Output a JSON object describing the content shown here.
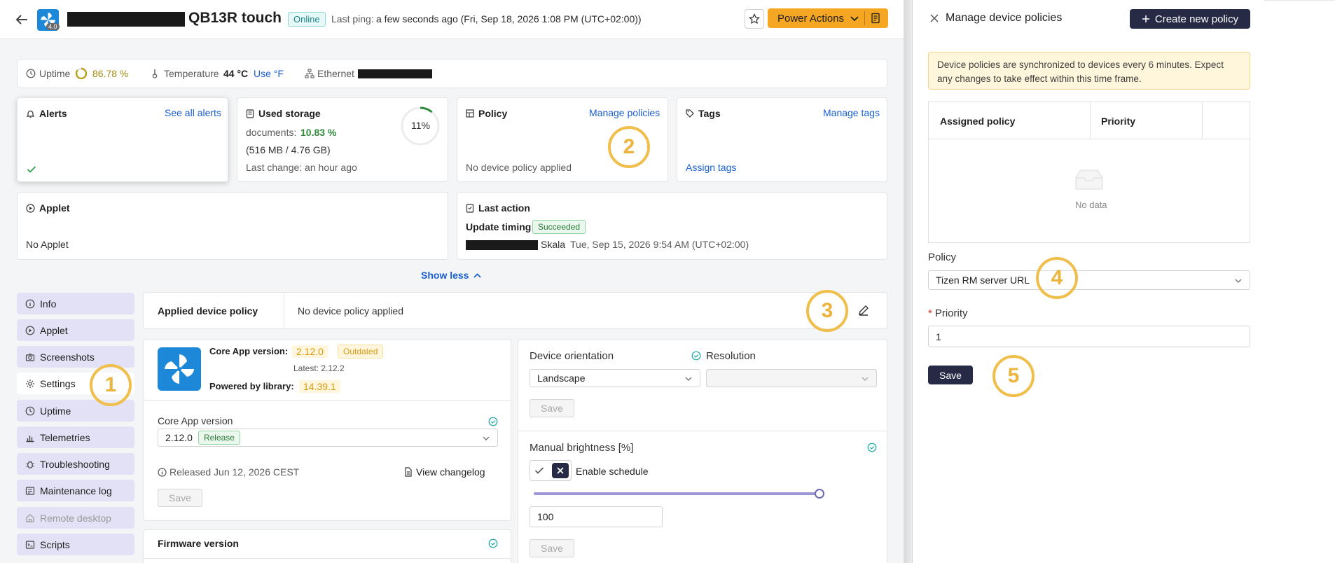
{
  "header": {
    "device_name": "QB13R touch",
    "version_badge": "4.0",
    "status": "Online",
    "last_ping_label": "Last ping:",
    "last_ping_value": "a few seconds ago (Fri, Sep 18, 2026 1:08 PM (UTC+02:00))",
    "power_actions": "Power Actions"
  },
  "info_bar": {
    "uptime_label": "Uptime",
    "uptime_value": "86.78 %",
    "temperature_label": "Temperature",
    "temperature_value": "44 °C",
    "use_f": "Use °F",
    "ethernet_label": "Ethernet"
  },
  "alerts": {
    "title": "Alerts",
    "see_all": "See all alerts"
  },
  "storage": {
    "title": "Used storage",
    "documents_label": "documents:",
    "documents_value": "10.83 %",
    "size": "(516 MB / 4.76 GB)",
    "last_change": "Last change: an hour ago",
    "ring_percent_label": "11%",
    "ring_fraction": 0.11
  },
  "policy": {
    "title": "Policy",
    "manage": "Manage policies",
    "none": "No device policy applied"
  },
  "tags": {
    "title": "Tags",
    "manage": "Manage tags",
    "assign": "Assign tags"
  },
  "applet": {
    "title": "Applet",
    "none": "No Applet"
  },
  "last_action": {
    "title": "Last action",
    "action": "Update timing",
    "status": "Succeeded",
    "user": "Skala",
    "time": "Tue, Sep 15, 2026 9:54 AM (UTC+02:00)"
  },
  "show_less": "Show less",
  "sidebar": {
    "items": [
      {
        "label": "Info",
        "icon": "info-icon"
      },
      {
        "label": "Applet",
        "icon": "play-circle-icon"
      },
      {
        "label": "Screenshots",
        "icon": "camera-icon"
      },
      {
        "label": "Settings",
        "icon": "gear-icon"
      },
      {
        "label": "Uptime",
        "icon": "clock-icon"
      },
      {
        "label": "Telemetries",
        "icon": "bar-chart-icon"
      },
      {
        "label": "Troubleshooting",
        "icon": "bug-icon"
      },
      {
        "label": "Maintenance log",
        "icon": "log-icon"
      },
      {
        "label": "Remote desktop",
        "icon": "remote-desktop-icon"
      },
      {
        "label": "Scripts",
        "icon": "script-icon"
      }
    ]
  },
  "applied_policy": {
    "label": "Applied device policy",
    "value": "No device policy applied"
  },
  "core_app": {
    "version_label": "Core App version:",
    "version": "2.12.0",
    "outdated": "Outdated",
    "latest": "Latest: 2.12.2",
    "library_label": "Powered by library:",
    "library": "14.39.1",
    "select_label": "Core App version",
    "select_value": "2.12.0",
    "select_tag": "Release",
    "released": "Released Jun 12, 2026 CEST",
    "changelog": "View changelog",
    "save": "Save"
  },
  "firmware": {
    "title": "Firmware version"
  },
  "orientation": {
    "label": "Device orientation",
    "value": "Landscape",
    "resolution_label": "Resolution",
    "save": "Save"
  },
  "brightness": {
    "label": "Manual brightness [%]",
    "schedule": "Enable schedule",
    "value": "100",
    "slider_fraction": 1.0,
    "save": "Save"
  },
  "panel": {
    "title": "Manage device policies",
    "create": "Create new policy",
    "notice": "Device policies are synchronized to devices every 6 minutes. Expect any changes to take effect within this time frame.",
    "columns": [
      "Assigned policy",
      "Priority",
      ""
    ],
    "empty": "No data",
    "policy_label": "Policy",
    "policy_value": "Tizen RM server URL",
    "priority_label": "Priority",
    "priority_value": "1",
    "save": "Save"
  },
  "annotations": [
    "1",
    "2",
    "3",
    "4",
    "5"
  ],
  "colors": {
    "accent": "#f5a623",
    "navy": "#262a45",
    "link": "#1a5fd0",
    "annotation": "#f0be4a"
  }
}
